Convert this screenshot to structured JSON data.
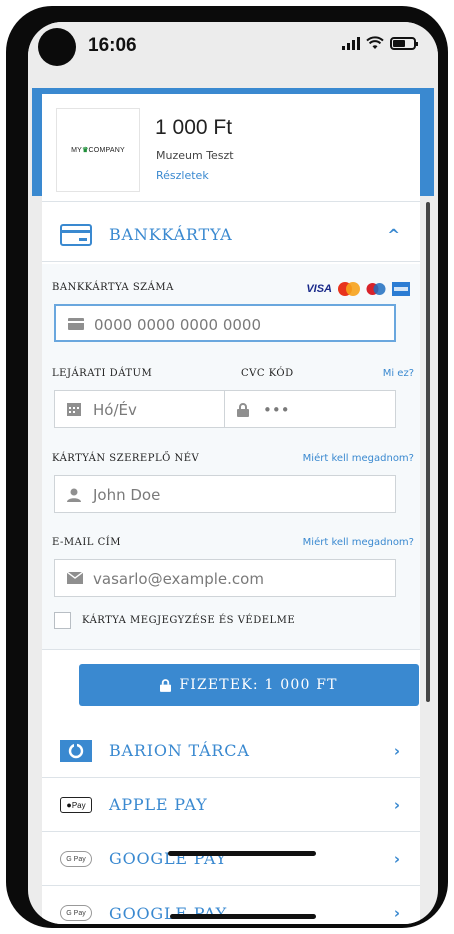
{
  "status_bar": {
    "time": "16:06"
  },
  "merchant": {
    "logo_text_a": "MY",
    "logo_text_b": "COMPANY",
    "amount": "1 000 Ft",
    "name": "Muzeum Teszt",
    "details_link": "Részletek"
  },
  "bank_card": {
    "title": "BANKKÁRTYA",
    "card_number_label": "BANKKÁRTYA SZÁMA",
    "card_brands": [
      "VISA",
      "Mastercard",
      "Maestro",
      "Amex"
    ],
    "card_number_placeholder": "0000 0000 0000 0000",
    "expiry_label": "LEJÁRATI DÁTUM",
    "expiry_placeholder": "Hó/Év",
    "cvc_label": "CVC KÓD",
    "cvc_help": "Mi ez?",
    "cvc_placeholder": "•••",
    "name_label": "KÁRTYÁN SZEREPLŐ NÉV",
    "name_help": "Miért kell megadnom?",
    "name_placeholder": "John Doe",
    "email_label": "E-MAIL CÍM",
    "email_help": "Miért kell megadnom?",
    "email_placeholder": "vasarlo@example.com",
    "remember_label": "KÁRTYA MEGJEGYZÉSE ÉS VÉDELME",
    "pay_button": "FIZETEK: 1 000 FT"
  },
  "methods": [
    {
      "label": "BARION TÁRCA",
      "icon": "barion-icon"
    },
    {
      "label": "APPLE PAY",
      "icon": "apple-pay-icon",
      "badge": "Pay"
    },
    {
      "label": "GOOGLE PAY",
      "icon": "google-pay-icon",
      "badge": "G Pay"
    },
    {
      "label": "GOOGLE PAY",
      "icon": "google-pay-icon",
      "badge": "G Pay"
    }
  ],
  "colors": {
    "accent": "#3a89d0",
    "form_bg": "#f6f9fb",
    "border": "#cfd4d8"
  }
}
